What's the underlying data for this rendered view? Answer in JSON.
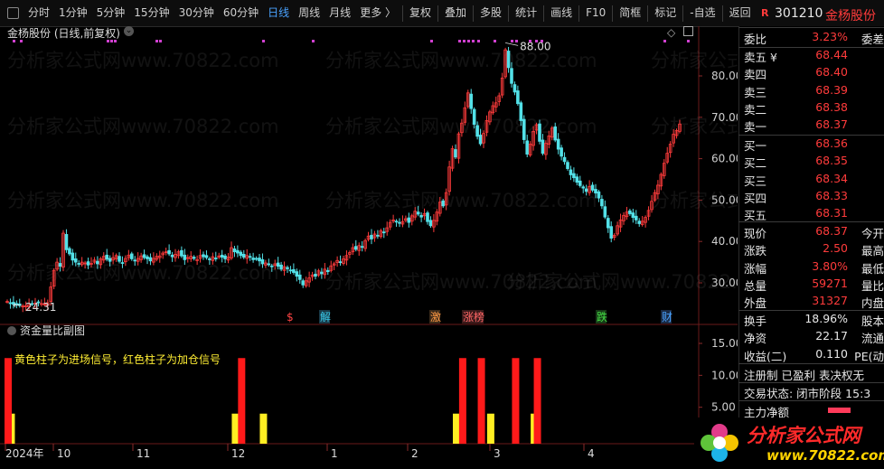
{
  "toolbar": {
    "periods": [
      "分时",
      "1分钟",
      "5分钟",
      "15分钟",
      "30分钟",
      "60分钟",
      "日线",
      "周线",
      "月线",
      "更多 〉"
    ],
    "active": "日线",
    "actions": [
      "复权",
      "叠加",
      "多股",
      "统计",
      "画线",
      "F10",
      "简框",
      "标记",
      "-自选",
      "返回"
    ]
  },
  "chart": {
    "title": "金杨股份 (日线,前复权)",
    "y_ticks": [
      "80.00",
      "70.00",
      "60.00",
      "50.00",
      "40.00",
      "30.00"
    ],
    "high_label": "88.00",
    "low_label": "24.31",
    "markers": [
      "$",
      "解",
      "激",
      "涨榜",
      "跌",
      "财"
    ],
    "x_labels": [
      "2024年",
      "10",
      "11",
      "12",
      "1",
      "2",
      "3",
      "4"
    ]
  },
  "sub": {
    "title": "资金量比副图",
    "note": "黄色柱子为进场信号，红色柱子为加仓信号",
    "y_ticks": [
      "15.00",
      "10.00",
      "5.00"
    ]
  },
  "chart_data": {
    "type": "bar",
    "title": "资金量比副图",
    "series": [
      {
        "name": "黄色柱子",
        "x": [
          1,
          73,
          82,
          144,
          155,
          169
        ],
        "values": [
          4,
          4,
          4,
          4,
          4,
          4
        ]
      },
      {
        "name": "红色柱子",
        "x": [
          0,
          75,
          146,
          152,
          163,
          170
        ],
        "values": [
          12.7,
          12.7,
          12.7,
          12.7,
          12.7,
          12.7
        ]
      }
    ],
    "ylim": [
      0,
      16
    ]
  },
  "quote": {
    "flag": "R",
    "code": "301210",
    "name": "金杨股份",
    "weibi_label": "委比",
    "weibi": "3.23%",
    "weicha": "委差",
    "sell": [
      {
        "label": "卖五 ¥",
        "price": "68.44"
      },
      {
        "label": "卖四",
        "price": "68.40"
      },
      {
        "label": "卖三",
        "price": "68.39"
      },
      {
        "label": "卖二",
        "price": "68.38"
      },
      {
        "label": "卖一",
        "price": "68.37"
      }
    ],
    "buy": [
      {
        "label": "买一",
        "price": "68.36"
      },
      {
        "label": "买二",
        "price": "68.35"
      },
      {
        "label": "买三",
        "price": "68.34"
      },
      {
        "label": "买四",
        "price": "68.33"
      },
      {
        "label": "买五",
        "price": "68.31"
      }
    ],
    "stats": [
      {
        "k": "现价",
        "v": "68.37",
        "e": "今开"
      },
      {
        "k": "涨跌",
        "v": "2.50",
        "e": "最高"
      },
      {
        "k": "涨幅",
        "v": "3.80%",
        "e": "最低"
      },
      {
        "k": "总量",
        "v": "59271",
        "e": "量比"
      },
      {
        "k": "外盘",
        "v": "31327",
        "e": "内盘"
      }
    ],
    "stats2": [
      {
        "k": "换手",
        "v": "18.96%",
        "e": "股本"
      },
      {
        "k": "净资",
        "v": "22.17",
        "e": "流通"
      },
      {
        "k": "收益(二)",
        "v": "0.110",
        "e": "PE(动"
      }
    ],
    "reg": "注册制  已盈利  表决权无",
    "state": "交易状态: 闭市阶段 15:3",
    "zhuli": "主力净额"
  },
  "watermark": "分析家公式网www.70822.com",
  "logo": {
    "text": "分析家公式网",
    "url": "www.70822.com"
  }
}
